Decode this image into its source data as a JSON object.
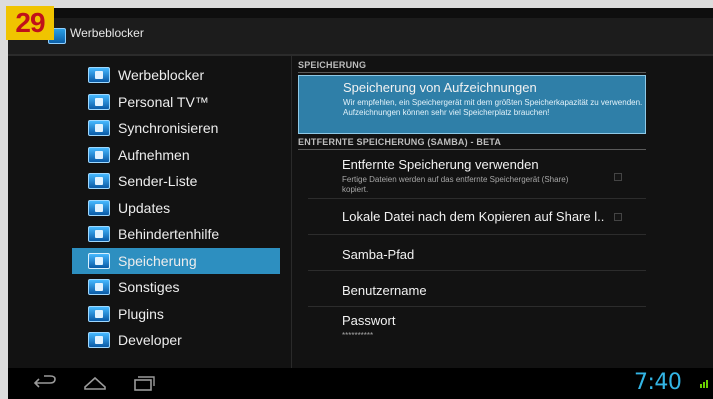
{
  "badge": "29",
  "window": {
    "title": "Werbeblocker"
  },
  "sidebar": {
    "items": [
      {
        "label": "Werbeblocker",
        "active": false
      },
      {
        "label": "Personal TV™",
        "active": false
      },
      {
        "label": "Synchronisieren",
        "active": false
      },
      {
        "label": "Aufnehmen",
        "active": false
      },
      {
        "label": "Sender-Liste",
        "active": false
      },
      {
        "label": "Updates",
        "active": false
      },
      {
        "label": "Behindertenhilfe",
        "active": false
      },
      {
        "label": "Speicherung",
        "active": true
      },
      {
        "label": "Sonstiges",
        "active": false
      },
      {
        "label": "Plugins",
        "active": false
      },
      {
        "label": "Developer",
        "active": false
      }
    ]
  },
  "preferences": {
    "section1": "SPEICHERUNG",
    "storage_title": "Speicherung von Aufzeichnungen",
    "storage_summary": "Wir empfehlen, ein Speichergerät mit dem größten Speicherkapazität zu verwenden. Aufzeichnungen können sehr viel Speicherplatz brauchen!",
    "section2": "ENTFERNTE SPEICHERUNG (SAMBA) - BETA",
    "remote_title": "Entfernte Speicherung verwenden",
    "remote_summary": "Fertige Dateien werden auf das entfernte Speichergerät (Share) kopiert.",
    "remote_checked": false,
    "local_title": "Lokale Datei nach dem Kopieren auf Share l..",
    "local_checked": false,
    "samba_path": "Samba-Pfad",
    "username": "Benutzername",
    "password_title": "Passwort",
    "password_value": "**********"
  },
  "navbar": {
    "clock": "7:40"
  },
  "colors": {
    "accent": "#33b5e5",
    "selected": "#2d8fc0",
    "badge_bg": "#f0c400",
    "badge_fg": "#c0101a"
  }
}
